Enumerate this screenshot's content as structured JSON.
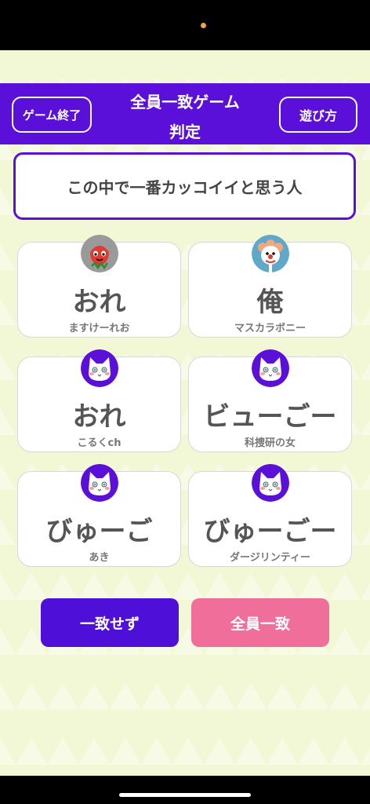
{
  "header": {
    "end_game_label": "ゲーム終了",
    "title_line1": "全員一致ゲーム",
    "title_line2": "判定",
    "how_to_play_label": "遊び方"
  },
  "question": "この中で一番カッコイイと思う人",
  "answers": [
    {
      "answer": "おれ",
      "player": "ますけーれお",
      "avatar": "strawberry-icon"
    },
    {
      "answer": "俺",
      "player": "マスカラボニー",
      "avatar": "clown-icon"
    },
    {
      "answer": "おれ",
      "player": "こるくch",
      "avatar": "cat-icon"
    },
    {
      "answer": "ビューごー",
      "player": "科捜研の女",
      "avatar": "cat-icon"
    },
    {
      "answer": "びゅーご",
      "player": "あき",
      "avatar": "cat-icon"
    },
    {
      "answer": "びゅーごー",
      "player": "ダージリンティー",
      "avatar": "cat-icon"
    }
  ],
  "actions": {
    "mismatch_label": "一致せず",
    "all_match_label": "全員一致"
  },
  "colors": {
    "primary": "#5a10d8",
    "accent_pink": "#ef6f9a",
    "background": "#f2f7d6"
  }
}
